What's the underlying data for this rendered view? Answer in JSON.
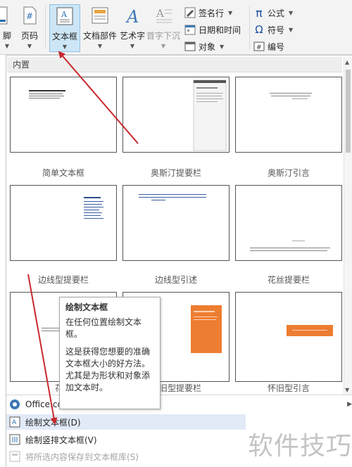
{
  "ribbon": {
    "footer_partial": "脚",
    "page_number": "页码",
    "page_number_glyph": "#",
    "text_box": "文本框",
    "quick_parts": "文档部件",
    "wordart": "艺术字",
    "dropcap": "首字下沉",
    "signature_line": "签名行",
    "date_time": "日期和时间",
    "object": "对象",
    "equation": "公式",
    "equation_glyph": "π",
    "symbol": "符号",
    "symbol_glyph": "Ω",
    "numbering": "编号"
  },
  "gallery": {
    "section_title": "内置",
    "items": [
      {
        "caption": "简单文本框"
      },
      {
        "caption": "奥斯汀提要栏"
      },
      {
        "caption": "奥斯汀引言"
      },
      {
        "caption": "边线型提要栏"
      },
      {
        "caption": "边线型引述"
      },
      {
        "caption": "花丝提要栏"
      },
      {
        "caption": "花丝"
      },
      {
        "caption": "怀旧型提要栏"
      },
      {
        "caption": "怀旧型引言"
      }
    ],
    "accent_color": "#ed7d31"
  },
  "menu": {
    "office_more": "Office.com",
    "draw_text_box": "绘制文本框(D)",
    "draw_vertical_text_box": "绘制竖排文本框(V)",
    "save_selection": "将所选内容保存到文本框库(S)"
  },
  "tooltip": {
    "title": "绘制文本框",
    "line1": "在任何位置绘制文本框。",
    "line2": "这是获得您想要的准确文本框大小的好方法。尤其是为形状和对象添加文本时。"
  },
  "watermark": "软件技巧",
  "colors": {
    "annotation_red": "#c8282d",
    "highlight": "#cde6f7"
  }
}
